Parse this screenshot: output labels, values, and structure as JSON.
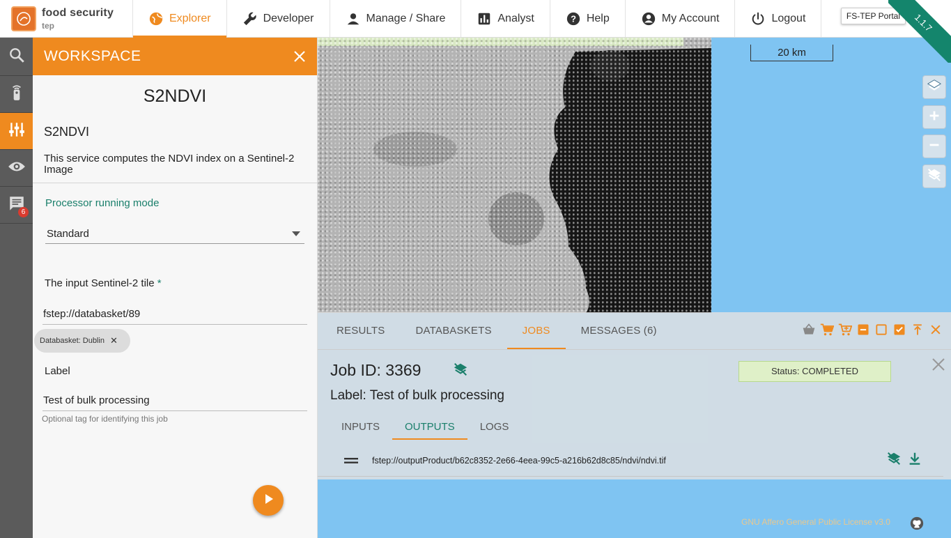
{
  "brand": {
    "name": "food security",
    "sub": "tep"
  },
  "nav": {
    "items": [
      {
        "label": "Explorer",
        "icon": "globe-icon",
        "active": true
      },
      {
        "label": "Developer",
        "icon": "wrench-icon"
      },
      {
        "label": "Manage / Share",
        "icon": "person-icon"
      },
      {
        "label": "Analyst",
        "icon": "chart-icon"
      },
      {
        "label": "Help",
        "icon": "help-icon"
      },
      {
        "label": "My Account",
        "icon": "account-icon"
      },
      {
        "label": "Logout",
        "icon": "power-icon"
      }
    ],
    "portal_badge": "FS-TEP Portal",
    "version": "1.1.7"
  },
  "rail": {
    "items": [
      {
        "icon": "search-icon"
      },
      {
        "icon": "remote-icon"
      },
      {
        "icon": "sliders-icon",
        "active": true
      },
      {
        "icon": "eye-icon"
      },
      {
        "icon": "message-icon",
        "badge": "6"
      }
    ]
  },
  "workspace": {
    "title": "WORKSPACE",
    "service_title": "S2NDVI",
    "service_name": "S2NDVI",
    "service_desc": "This service computes the NDVI index on a Sentinel-2 Image",
    "mode_label": "Processor running mode",
    "mode_value": "Standard",
    "input_label": "The input Sentinel-2 tile",
    "input_required": "*",
    "input_value": "fstep://databasket/89",
    "chip_label": "Databasket: Dublin",
    "chip_close": "✕",
    "label_label": "Label",
    "label_value": "Test of bulk processing",
    "label_hint": "Optional tag for identifying this job"
  },
  "map": {
    "scale": "20 km",
    "license": "GNU Affero General Public License v3.0",
    "sea_color": "#7fc4f2"
  },
  "results": {
    "tabs": [
      {
        "label": "RESULTS"
      },
      {
        "label": "DATABASKETS"
      },
      {
        "label": "JOBS",
        "active": true
      },
      {
        "label": "MESSAGES (6)"
      }
    ],
    "job_id": "Job ID: 3369",
    "status": "Status: COMPLETED",
    "job_label": "Label: Test of bulk processing",
    "subtabs": [
      {
        "label": "INPUTS"
      },
      {
        "label": "OUTPUTS",
        "active": true
      },
      {
        "label": "LOGS"
      }
    ],
    "output_path": "fstep://outputProduct/b62c8352-2e66-4eea-99c5-a216b62d8c85/ndvi/ndvi.tif"
  },
  "colors": {
    "accent": "#ef8a1f",
    "green": "#1a7f6b",
    "ribbon": "#14856c",
    "status_bg": "#dff0c8"
  }
}
